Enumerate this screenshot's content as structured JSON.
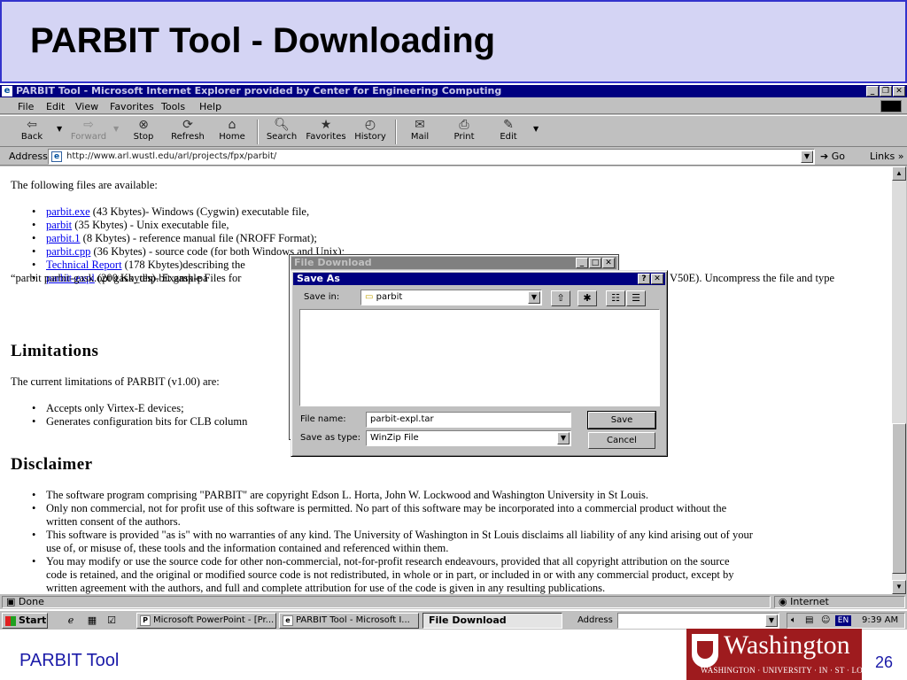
{
  "slide": {
    "title": "PARBIT Tool - Downloading",
    "footer_left": "PARBIT Tool",
    "page_number": "26",
    "logo_name": "Washington",
    "logo_sub": "WASHINGTON · UNIVERSITY · IN · ST · LOUIS"
  },
  "ie": {
    "window_title": "PARBIT Tool - Microsoft Internet Explorer provided by Center for Engineering Computing",
    "menu": [
      "File",
      "Edit",
      "View",
      "Favorites",
      "Tools",
      "Help"
    ],
    "toolbar": {
      "back": "Back",
      "forward": "Forward",
      "stop": "Stop",
      "refresh": "Refresh",
      "home": "Home",
      "search": "Search",
      "favorites": "Favorites",
      "history": "History",
      "mail": "Mail",
      "print": "Print",
      "edit": "Edit"
    },
    "address_label": "Address",
    "url": "http://www.arl.wustl.edu/arl/projects/fpx/parbit/",
    "go_label": "Go",
    "links_label": "Links"
  },
  "page": {
    "intro": "The following files are available:",
    "files": [
      {
        "link": "parbit.exe",
        "text": " (43 Kbytes)- Windows (Cygwin) executable file,"
      },
      {
        "link": "parbit",
        "text": " (35 Kbytes) - Unix executable file,"
      },
      {
        "link": "parbit.1",
        "text": " (8 Kbytes) - reference manual file (NROFF Format);"
      },
      {
        "link": "parbit.cpp",
        "text": " (36 Kbytes) - source code (for both Windows and Unix);"
      },
      {
        "link": "Technical Report",
        "text": " (178 Kbytes)describing the"
      },
      {
        "link": "parbit-expl",
        "text": " (200 Kbytes)- Example Files for"
      }
    ],
    "expl_right": "V50E). Uncompress the file and type",
    "expl_line2": "“parbit parbit-gask.opt gask_dhp.bit gask-pa",
    "limitations_heading": "Limitations",
    "limitations_intro": "The current limitations of PARBIT (v1.00) are:",
    "limitations": [
      "Accepts only Virtex-E devices;",
      "Generates configuration bits for CLB column"
    ],
    "disclaimer_heading": "Disclaimer",
    "disclaimer": [
      "The software program comprising \"PARBIT\" are copyright Edson L. Horta, John W. Lockwood and Washington University in St Louis.",
      "Only non commercial, not for profit use of this software is permitted. No part of this software may be incorporated into a commercial product without the",
      "written consent of the authors.",
      "This software is provided \"as is\" with no warranties of any kind. The University of Washington in St Louis disclaims all liability of any kind arising out of your",
      "use of, or misuse of, these tools and the information contained and referenced within them.",
      "You may modify or use the source code for other non-commercial, not-for-profit research endeavours, provided that all copyright attribution on the source",
      "code is retained, and the original or modified source code is not redistributed, in whole or in part, or included in or with any commercial product, except by",
      "written agreement with the authors, and full and complete attribution for use of the code is given in any resulting publications."
    ]
  },
  "status": {
    "left": "Done",
    "zone": "Internet"
  },
  "taskbar": {
    "start": "Start",
    "tasks": [
      "Microsoft PowerPoint - [Pr...",
      "PARBIT Tool - Microsoft I...",
      "File Download"
    ],
    "address_label": "Address",
    "lang": "EN",
    "time": "9:39 AM"
  },
  "file_download": {
    "title": "File Download"
  },
  "save_as": {
    "title": "Save As",
    "save_in_label": "Save in:",
    "save_in_value": "parbit",
    "file_name_label": "File name:",
    "file_name_value": "parbit-expl.tar",
    "save_type_label": "Save as type:",
    "save_type_value": "WinZip File",
    "save_button": "Save",
    "cancel_button": "Cancel"
  }
}
